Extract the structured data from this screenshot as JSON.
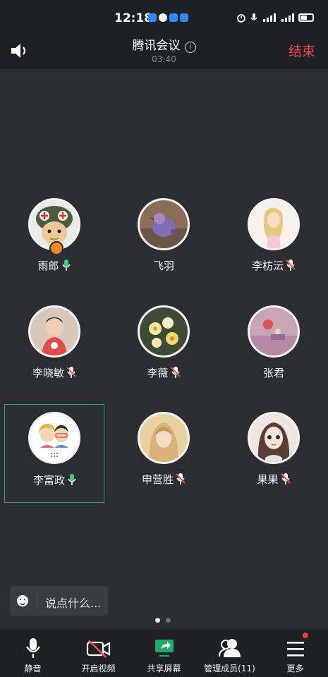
{
  "status_bar": {
    "time": "12:18",
    "signal_left": "4G",
    "signal_right": "4G"
  },
  "header": {
    "title": "腾讯会议",
    "timer": "03:40",
    "end_label": "结束",
    "end_color": "#f04b4b"
  },
  "participants": [
    {
      "name": "雨郎",
      "mic": "on",
      "host": true,
      "avatar": "soldier-cartoon-avatar"
    },
    {
      "name": "飞羽",
      "mic": "none",
      "host": false,
      "avatar": "bird-avatar"
    },
    {
      "name": "李枋沄",
      "mic": "muted",
      "host": false,
      "avatar": "girl-illustration-avatar"
    },
    {
      "name": "李晓敏",
      "mic": "muted",
      "host": false,
      "avatar": "child-photo-avatar"
    },
    {
      "name": "李薇",
      "mic": "muted",
      "host": false,
      "avatar": "flowers-avatar"
    },
    {
      "name": "张君",
      "mic": "none",
      "host": false,
      "avatar": "pink-scene-avatar"
    },
    {
      "name": "李富政",
      "mic": "on",
      "host": false,
      "active": true,
      "avatar": "couple-cartoon-avatar"
    },
    {
      "name": "申营胜",
      "mic": "muted",
      "host": false,
      "avatar": "woman-photo-avatar"
    },
    {
      "name": "果果",
      "mic": "muted",
      "host": false,
      "avatar": "anime-woman-avatar"
    }
  ],
  "chat": {
    "placeholder": "说点什么..."
  },
  "pager": {
    "current": 1,
    "total": 2
  },
  "toolbar": [
    {
      "label": "静音",
      "icon": "mic-icon"
    },
    {
      "label": "开启视频",
      "icon": "video-off-icon"
    },
    {
      "label": "共享屏幕",
      "icon": "share-screen-icon"
    },
    {
      "label": "管理成员(11)",
      "icon": "members-icon"
    },
    {
      "label": "更多",
      "icon": "more-menu-icon"
    }
  ],
  "colors": {
    "accent_green": "#22a86a",
    "mic_on": "#3ccf7a",
    "mic_muted": "#ff4d4f",
    "background": "#2b2d31"
  }
}
